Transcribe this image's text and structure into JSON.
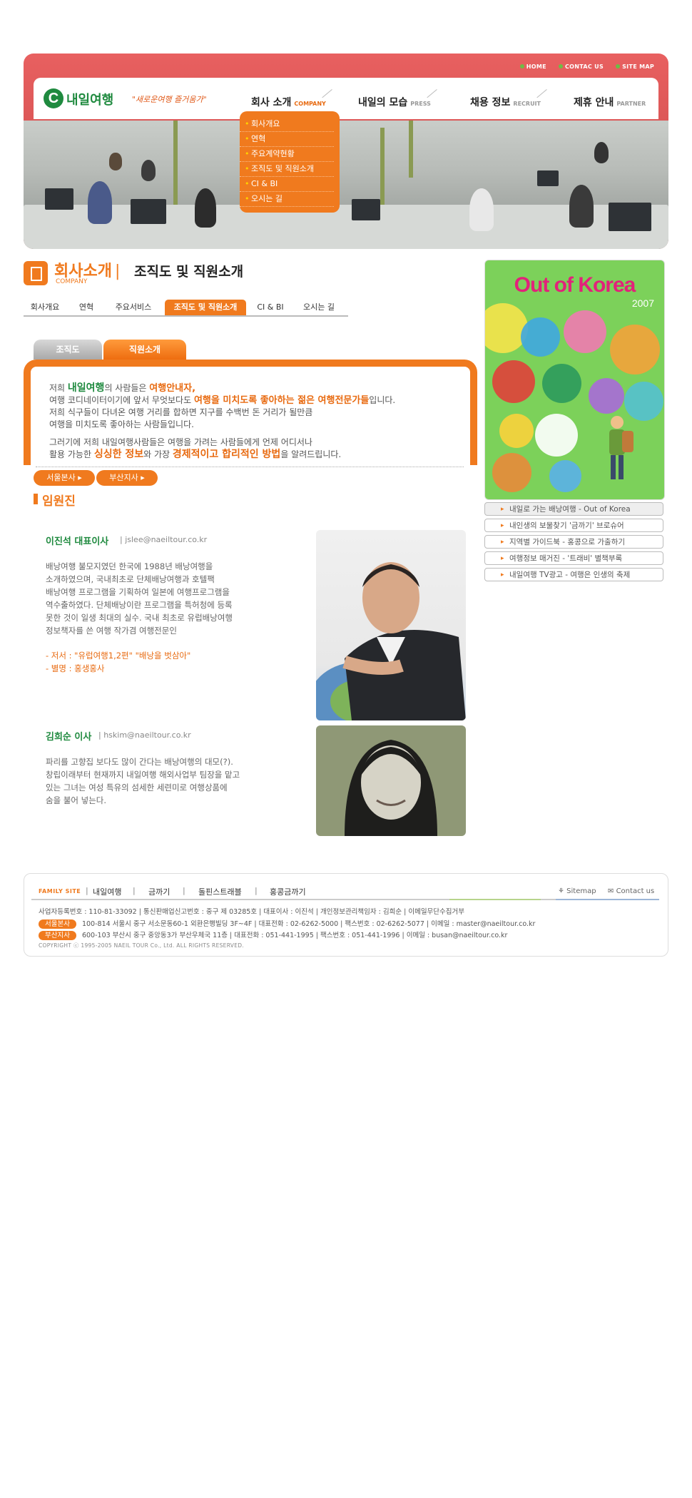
{
  "header": {
    "util_nav": [
      "HOME",
      "CONTAC US",
      "SITE MAP"
    ],
    "logo_text": "내일여행",
    "tagline": "\"새로운여행 즐거움가\"",
    "gnb": [
      {
        "label": "회사 소개",
        "en": "COMPANY"
      },
      {
        "label": "내일의 모습",
        "en": "PRESS"
      },
      {
        "label": "채용 정보",
        "en": "RECRUIT"
      },
      {
        "label": "제휴 안내",
        "en": "PARTNER"
      }
    ],
    "submenu": [
      "회사개요",
      "연혁",
      "주요계약현황",
      "조직도 및 직원소개",
      "CI & BI",
      "오시는 길"
    ]
  },
  "page": {
    "title": "회사소개",
    "title_sub": "조직도 및 직원소개",
    "title_en": "COMPANY",
    "subtabs": [
      "회사개요",
      "연혁",
      "주요서비스",
      "조직도 및 직원소개",
      "CI & BI",
      "오시는 길"
    ],
    "content_tabs": [
      "조직도",
      "직원소개"
    ],
    "intro": {
      "p1_a": "저희 ",
      "p1_brand": "내일여행",
      "p1_b": "의 사람들은 ",
      "p1_hl": "여행안내자,",
      "p2_a": "여행 코디네이터이기에 앞서 무엇보다도 ",
      "p2_hl": "여행을 미치도록 좋아하는 젊은 여행전문가들",
      "p2_b": "입니다.",
      "p3": "저희 식구들이 다녀온 여행 거리를 합하면 지구를 수백번 돈 거리가 될만큼",
      "p4": "여행을 미치도록 좋아하는 사람들입니다.",
      "p5": "그러기에 저희 내일여행사람들은 여행을 가려는 사람들에게 언제 어디서나",
      "p6_a": "활용 가능한 ",
      "p6_hl1": "싱싱한 정보",
      "p6_b": "와 가장 ",
      "p6_hl2": "경제적이고 합리적인 방법",
      "p6_c": "을 알려드립니다."
    },
    "branches": [
      "서울본사",
      "부산지사"
    ],
    "section_title": "임원진",
    "staff": [
      {
        "name": "이진석 대표이사",
        "email": "jslee@naeiltour.co.kr",
        "bio": [
          "배낭여행 불모지였던 한국에 1988년 배낭여행을",
          "소개하였으며, 국내최초로 단체배낭여행과 호텔팩",
          "배낭여행 프로그램을 기획하여 일본에 여행프로그램을",
          "역수출하였다. 단체배낭이란 프로그램을 특허청에 등록",
          "못한 것이 일생 최대의 실수. 국내 최초로 유럽배낭여행",
          "정보책자를 쓴 여행 작가겸 여행전문인"
        ],
        "notes": [
          "- 저서 : \"유럽여행1,2편\" \"배낭을 벗삼아\"",
          "- 별명 : 홍생홍사"
        ]
      },
      {
        "name": "김희순 이사",
        "email": "hskim@naeiltour.co.kr",
        "bio": [
          "파리를 고향집 보다도 많이 간다는 배낭여행의 대모(?).",
          "창립이래부터 현재까지 내일여행 해외사업부 팀장을 맡고",
          "있는 그녀는 여성 특유의 섬세한 세련미로 여행상품에",
          "숨을 불어 넣는다."
        ],
        "notes": []
      }
    ]
  },
  "sidebar": {
    "poster_title": "Out of Korea",
    "poster_year": "2007",
    "links": [
      "내일로 가는 배낭여행 - Out of Korea",
      "내인생의 보물찾기 '금까기' 브로슈어",
      "지역별 가이드북 - 홍콩으로 가출하기",
      "여행정보 매거진 - '트래비' 별책부록",
      "내일여행 TV광고 - 여행은 인생의 축제"
    ]
  },
  "footer": {
    "family_label": "FAMILY SITE",
    "family_links": [
      "내일여행",
      "금까기",
      "돌핀스트래블",
      "홍콩금까기"
    ],
    "sitemap": "Sitemap",
    "contact": "Contact us",
    "biz_line": "사업자등록번호 : 110-81-33092 | 통신판매업신고번호 : 중구 제 03285호 | 대표이사 : 이진석 | 개인정보관리책임자 : 김희순 | 이메일무단수집거부",
    "seoul_badge": "서울본사",
    "seoul_line": "100-814 서울시 중구 서소문동60-1 외환은행빌딩 3F~4F | 대표전화 : 02-6262-5000 | 팩스번호 : 02-6262-5077 | 이메일 : master@naeiltour.co.kr",
    "busan_badge": "부산지사",
    "busan_line": "600-103 부산시 중구 중앙동3가 부산우체국 11층 | 대표전화 : 051-441-1995 | 팩스번호 : 051-441-1996 | 이메일 : busan@naeiltour.co.kr",
    "copyright": "COPYRIGHT ⓒ 1995-2005 NAEIL TOUR Co., Ltd. ALL RIGHTS RESERVED."
  },
  "colors": {
    "accent": "#f07a1e",
    "brand_green": "#1f8a3f",
    "header_red": "#d85050"
  }
}
